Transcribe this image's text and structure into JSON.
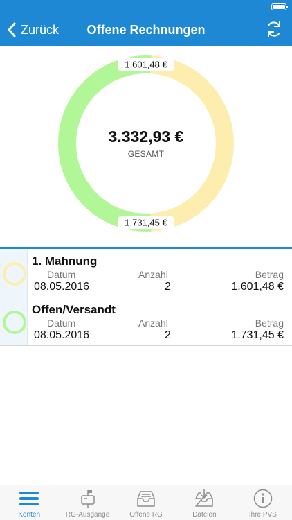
{
  "nav": {
    "back_label": "Zurück",
    "title": "Offene Rechnungen"
  },
  "summary": {
    "total": "3.332,93 €",
    "total_label": "GESAMT"
  },
  "chart_data": {
    "type": "pie",
    "categories": [
      "1. Mahnung",
      "Offen/Versandt"
    ],
    "values": [
      1601.48,
      1731.45
    ],
    "labels": [
      "1.601,48 €",
      "1.731,45 €"
    ],
    "colors": [
      "#fdeeb0",
      "#b1f797"
    ],
    "title": "3.332,93 €",
    "subtitle": "GESAMT"
  },
  "items": [
    {
      "title": "1. Mahnung",
      "date_label": "Datum",
      "date": "08.05.2016",
      "count_label": "Anzahl",
      "count": "2",
      "amount_label": "Betrag",
      "amount": "1.601,48 €",
      "color": "#fdeeb0"
    },
    {
      "title": "Offen/Versandt",
      "date_label": "Datum",
      "date": "08.05.2016",
      "count_label": "Anzahl",
      "count": "2",
      "amount_label": "Betrag",
      "amount": "1.731,45 €",
      "color": "#b1f797"
    }
  ],
  "tabs": [
    {
      "label": "Konten",
      "icon": "menu-icon",
      "active": true
    },
    {
      "label": "RG-Ausgänge",
      "icon": "mailbox-icon",
      "active": false
    },
    {
      "label": "Offene RG",
      "icon": "inbox-icon",
      "active": false
    },
    {
      "label": "Dateien",
      "icon": "download-tray-icon",
      "active": false
    },
    {
      "label": "Ihre PVS",
      "icon": "info-icon",
      "active": false
    }
  ],
  "colors": {
    "accent": "#1e88d4",
    "tab_inactive": "#8e8e93"
  }
}
